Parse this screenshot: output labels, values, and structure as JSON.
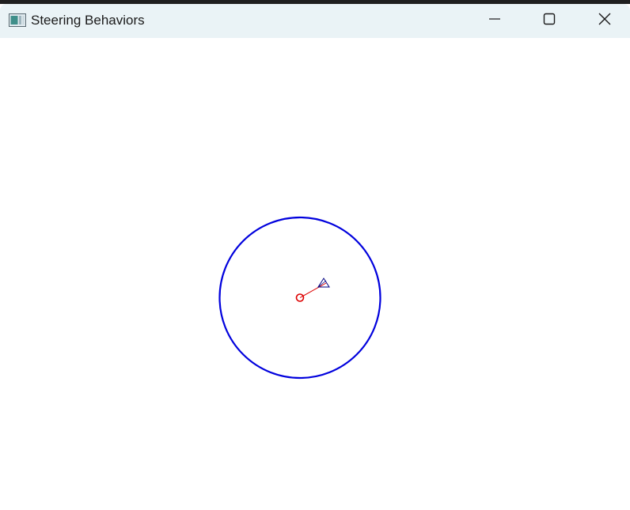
{
  "window": {
    "title": "Steering Behaviors",
    "icon": "app-window-icon"
  },
  "caption_buttons": {
    "minimize_icon": "minimize-icon",
    "maximize_icon": "maximize-icon",
    "close_icon": "close-icon"
  },
  "scene": {
    "wander_circle_color": "#0000dd",
    "target_color": "#dd0000",
    "agent_color": "#000080"
  }
}
